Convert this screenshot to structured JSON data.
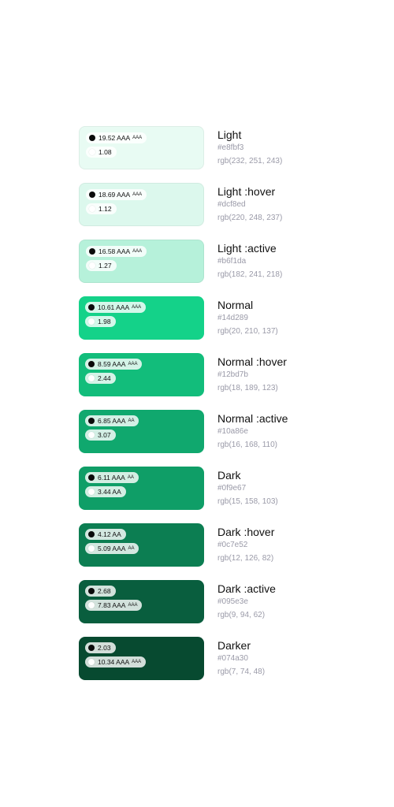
{
  "swatches": [
    {
      "name": "Light",
      "hex": "#e8fbf3",
      "rgb": "rgb(232, 251, 243)",
      "color": "#e8fbf3",
      "black": {
        "ratio": "19.52 AAA",
        "badge": "AAA"
      },
      "white": {
        "ratio": "1.08",
        "badge": ""
      }
    },
    {
      "name": "Light :hover",
      "hex": "#dcf8ed",
      "rgb": "rgb(220, 248, 237)",
      "color": "#dcf8ed",
      "black": {
        "ratio": "18.69 AAA",
        "badge": "AAA"
      },
      "white": {
        "ratio": "1.12",
        "badge": ""
      }
    },
    {
      "name": "Light :active",
      "hex": "#b6f1da",
      "rgb": "rgb(182, 241, 218)",
      "color": "#b6f1da",
      "black": {
        "ratio": "16.58 AAA",
        "badge": "AAA"
      },
      "white": {
        "ratio": "1.27",
        "badge": ""
      }
    },
    {
      "name": "Normal",
      "hex": "#14d289",
      "rgb": "rgb(20, 210, 137)",
      "color": "#14d289",
      "black": {
        "ratio": "10.61 AAA",
        "badge": "AAA"
      },
      "white": {
        "ratio": "1.98",
        "badge": ""
      }
    },
    {
      "name": "Normal :hover",
      "hex": "#12bd7b",
      "rgb": "rgb(18, 189, 123)",
      "color": "#12bd7b",
      "black": {
        "ratio": "8.59 AAA",
        "badge": "AAA"
      },
      "white": {
        "ratio": "2.44",
        "badge": ""
      }
    },
    {
      "name": "Normal :active",
      "hex": "#10a86e",
      "rgb": "rgb(16, 168, 110)",
      "color": "#10a86e",
      "black": {
        "ratio": "6.85 AAA",
        "badge": "AA"
      },
      "white": {
        "ratio": "3.07",
        "badge": ""
      }
    },
    {
      "name": "Dark",
      "hex": "#0f9e67",
      "rgb": "rgb(15, 158, 103)",
      "color": "#0f9e67",
      "black": {
        "ratio": "6.11 AAA",
        "badge": "AA"
      },
      "white": {
        "ratio": "3.44 AA",
        "badge": ""
      }
    },
    {
      "name": "Dark :hover",
      "hex": "#0c7e52",
      "rgb": "rgb(12, 126, 82)",
      "color": "#0c7e52",
      "black": {
        "ratio": "4.12 AA",
        "badge": ""
      },
      "white": {
        "ratio": "5.09 AAA",
        "badge": "AA"
      }
    },
    {
      "name": "Dark :active",
      "hex": "#095e3e",
      "rgb": "rgb(9, 94, 62)",
      "color": "#095e3e",
      "black": {
        "ratio": "2.68",
        "badge": ""
      },
      "white": {
        "ratio": "7.83 AAA",
        "badge": "AAA"
      }
    },
    {
      "name": "Darker",
      "hex": "#074a30",
      "rgb": "rgb(7, 74, 48)",
      "color": "#074a30",
      "black": {
        "ratio": "2.03",
        "badge": ""
      },
      "white": {
        "ratio": "10.34 AAA",
        "badge": "AAA"
      }
    }
  ]
}
